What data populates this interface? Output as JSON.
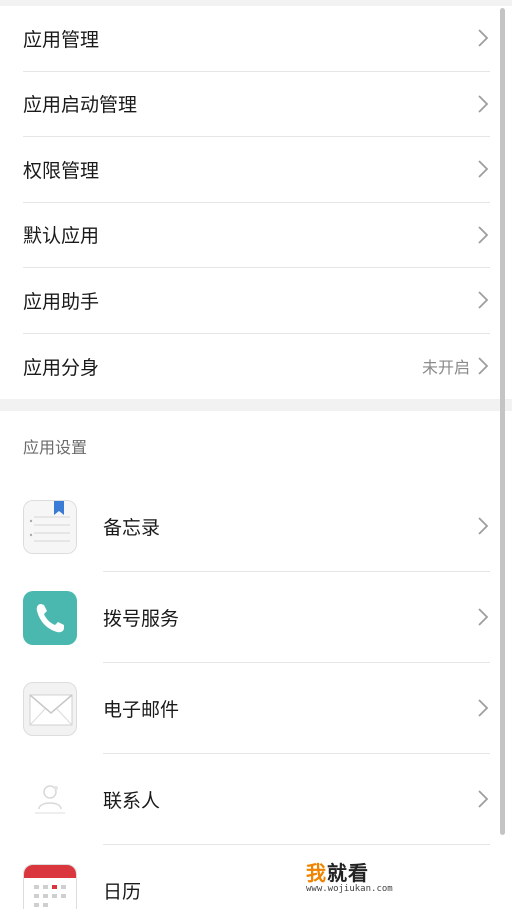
{
  "menu": {
    "items": [
      {
        "label": "应用管理",
        "value": ""
      },
      {
        "label": "应用启动管理",
        "value": ""
      },
      {
        "label": "权限管理",
        "value": ""
      },
      {
        "label": "默认应用",
        "value": ""
      },
      {
        "label": "应用助手",
        "value": ""
      },
      {
        "label": "应用分身",
        "value": "未开启"
      }
    ]
  },
  "app_settings": {
    "title": "应用设置",
    "apps": [
      {
        "label": "备忘录",
        "icon": "notepad-icon"
      },
      {
        "label": "拨号服务",
        "icon": "phone-icon"
      },
      {
        "label": "电子邮件",
        "icon": "mail-icon"
      },
      {
        "label": "联系人",
        "icon": "contacts-icon"
      },
      {
        "label": "日历",
        "icon": "calendar-icon"
      }
    ]
  },
  "watermark": {
    "first_char": "我",
    "rest": "就看",
    "url": "www.wojiukan.com"
  },
  "colors": {
    "phone_teal": "#4bb8b0",
    "calendar_red": "#d9363e",
    "notepad_blue": "#3a7bd5",
    "watermark_orange": "#f08300"
  }
}
